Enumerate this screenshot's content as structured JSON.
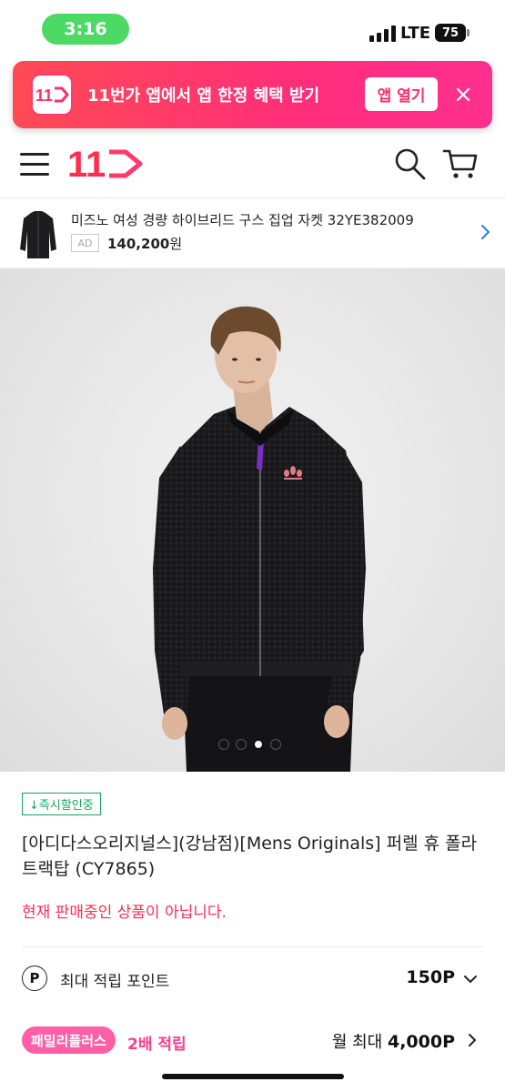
{
  "status_bar": {
    "time": "3:16",
    "network": "LTE",
    "battery": "75"
  },
  "promo_banner": {
    "logo_text": "11",
    "text": "11번가 앱에서 앱 한정 혜택 받기",
    "open_button": "앱 열기",
    "close_icon": "close-icon"
  },
  "header": {
    "menu_icon": "hamburger-menu-icon",
    "logo_text": "11",
    "search_icon": "search-icon",
    "cart_icon": "cart-icon"
  },
  "ad": {
    "title": "미즈노 여성 경량 하이브리드 구스 집업 자켓 32YE382009",
    "badge": "AD",
    "price": "140,200",
    "price_unit": "원"
  },
  "gallery": {
    "total_images": 4,
    "active_index": 2
  },
  "product": {
    "badge": "↓즉시할인중",
    "title": "[아디다스오리지널스](강남점)[Mens Originals] 퍼렐 휴 폴라 트랙탑 (CY7865)",
    "status": "현재 판매중인 상품이 아닙니다."
  },
  "points": {
    "icon_letter": "P",
    "label": "최대 적립 포인트",
    "value": "150P"
  },
  "family_plus": {
    "badge": "패밀리플러스",
    "double": "2배 적립",
    "max_label": "월 최대",
    "max_value": "4,000P"
  },
  "colors": {
    "brand_pink": "#ff2e6e",
    "status_green": "#4cd964",
    "badge_green": "#19a35e",
    "warning_red": "#ff2d55"
  }
}
